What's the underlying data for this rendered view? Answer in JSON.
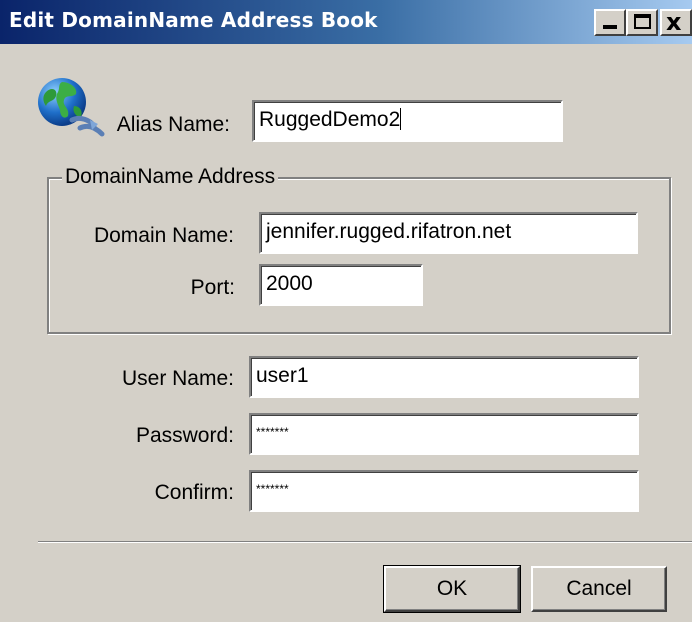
{
  "window": {
    "title": "Edit DomainName Address Book",
    "controls": {
      "minimize": "minimize",
      "maximize": "maximize",
      "close": "x"
    }
  },
  "alias": {
    "label": "Alias Name:",
    "value": "RuggedDemo2"
  },
  "domain_group": {
    "legend": "DomainName Address",
    "domain_name": {
      "label": "Domain Name:",
      "value": "jennifer.rugged.rifatron.net"
    },
    "port": {
      "label": "Port:",
      "value": "2000"
    }
  },
  "user_name": {
    "label": "User Name:",
    "value": "user1"
  },
  "password": {
    "label": "Password:",
    "value": "*******"
  },
  "confirm": {
    "label": "Confirm:",
    "value": "*******"
  },
  "buttons": {
    "ok": "OK",
    "cancel": "Cancel"
  },
  "icons": {
    "app": "globe-network-icon"
  },
  "colors": {
    "titlebar_start": "#0a246a",
    "titlebar_end": "#a6caf0",
    "window_bg": "#d4d0c8"
  }
}
